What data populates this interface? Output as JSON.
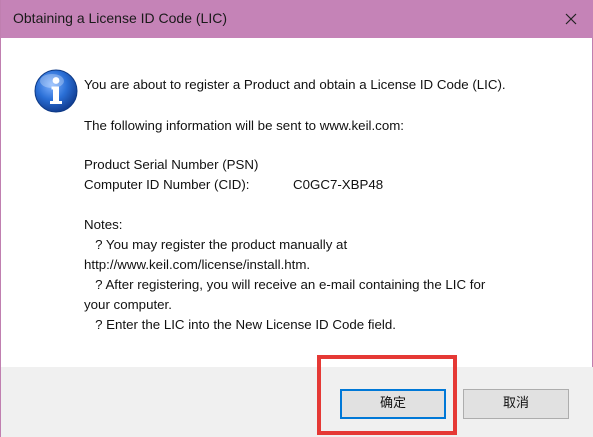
{
  "window": {
    "title": "Obtaining a License ID Code (LIC)"
  },
  "message": {
    "line1": "You are about to register a Product and obtain a License ID Code (LIC).",
    "line2": "The following information will be sent to www.keil.com:",
    "psn_label": "Product Serial Number (PSN)",
    "cid_label": "Computer ID Number (CID):",
    "cid_value": "C0GC7-XBP48",
    "notes_heading": "Notes:",
    "note1_a": "   ? You may register the product manually at",
    "note1_b": "http://www.keil.com/license/install.htm.",
    "note2_a": "   ? After registering, you will receive an e-mail containing the LIC for",
    "note2_b": "your computer.",
    "note3": "   ? Enter the LIC into the New License ID Code field."
  },
  "buttons": {
    "ok_label": "确定",
    "cancel_label": "取消"
  },
  "colors": {
    "titlebar": "#c583b7",
    "highlight": "#e53935",
    "icon_blue": "#1e63c4"
  },
  "icons": {
    "info": "information-icon",
    "close": "close-icon"
  }
}
